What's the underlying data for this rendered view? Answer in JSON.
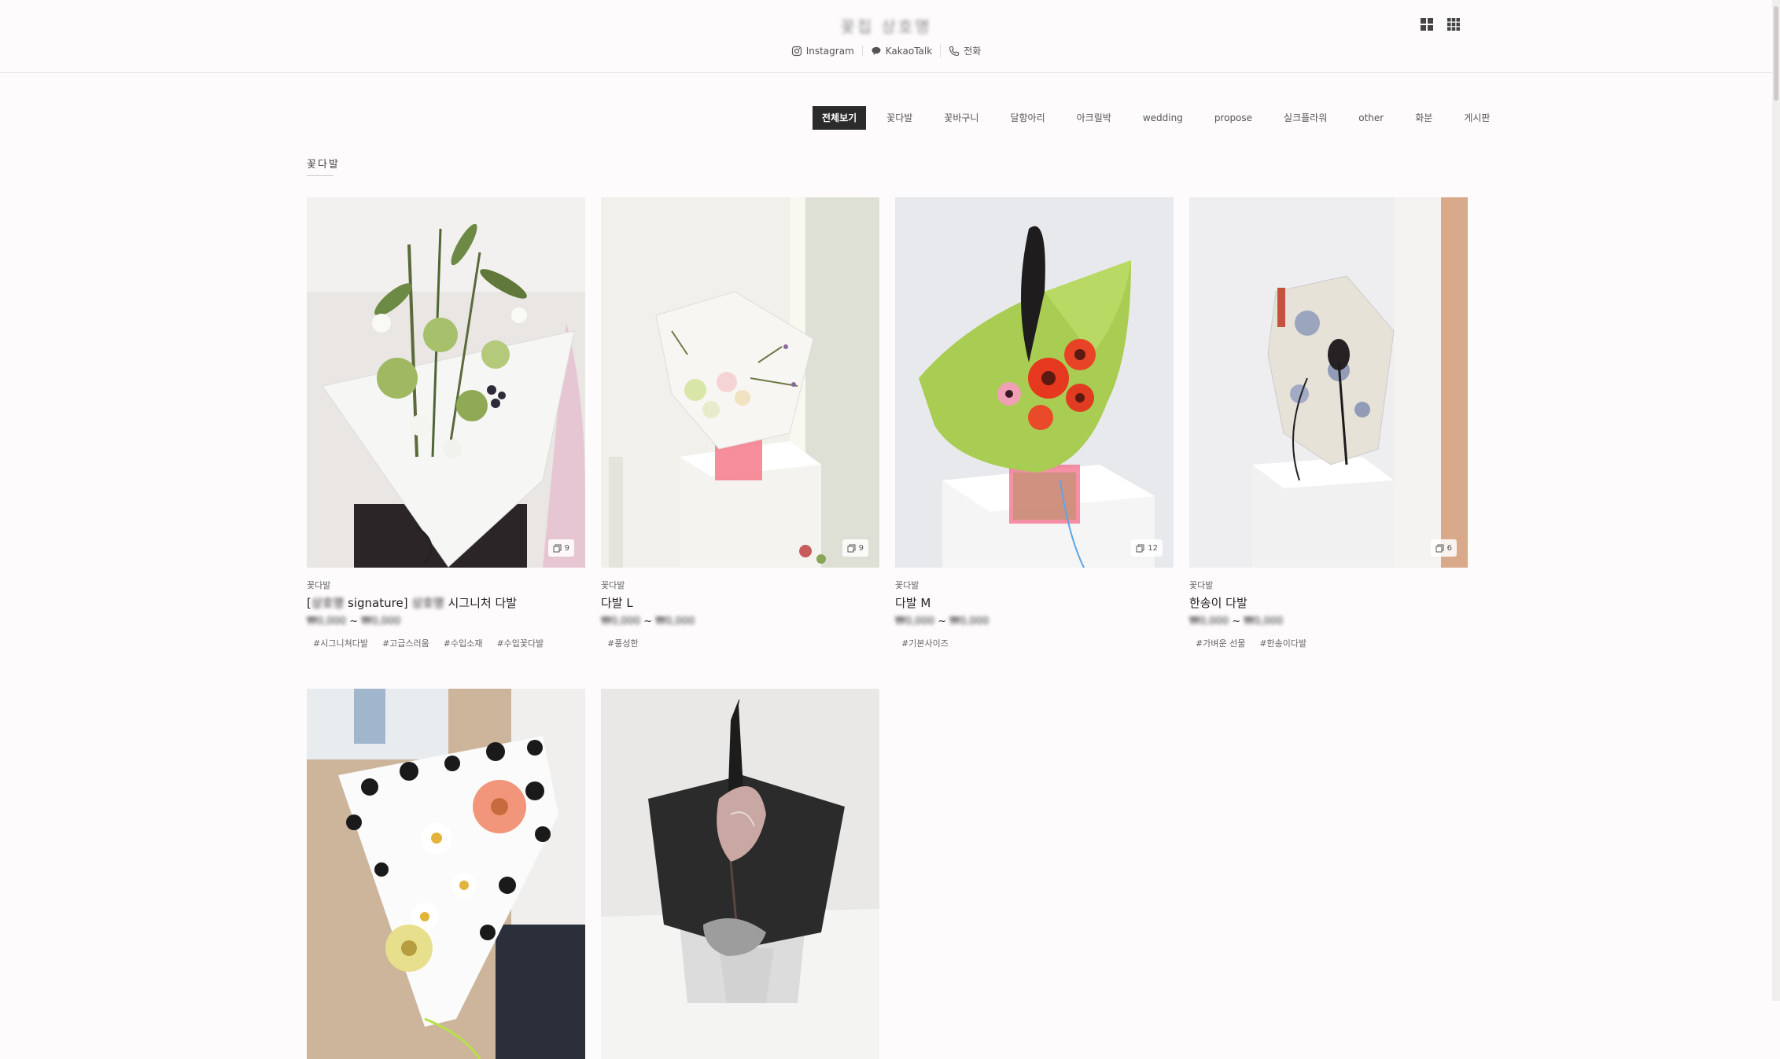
{
  "header": {
    "logo_text": "꽃집 상호명",
    "contacts": [
      {
        "label": "Instagram",
        "icon": "instagram-icon"
      },
      {
        "label": "KakaoTalk",
        "icon": "chat-bubble-icon"
      },
      {
        "label": "전화",
        "icon": "phone-icon"
      }
    ],
    "view_toggles": [
      "grid-2x2-icon",
      "grid-3x3-icon"
    ]
  },
  "tabs": [
    {
      "label": "전체보기",
      "active": true
    },
    {
      "label": "꽃다발",
      "active": false
    },
    {
      "label": "꽃바구니",
      "active": false
    },
    {
      "label": "달항아리",
      "active": false
    },
    {
      "label": "아크릴박",
      "active": false
    },
    {
      "label": "wedding",
      "active": false
    },
    {
      "label": "propose",
      "active": false
    },
    {
      "label": "실크플라워",
      "active": false
    },
    {
      "label": "other",
      "active": false
    },
    {
      "label": "화분",
      "active": false
    },
    {
      "label": "게시판",
      "active": false
    }
  ],
  "section": {
    "title": "꽃다발"
  },
  "products": [
    {
      "category": "꽃다발",
      "title_pre": "[",
      "title_blur_1": "상호명",
      "title_mid": " signature] ",
      "title_blur_2": "상호명",
      "title_post": " 시그니처 다발",
      "price_low": "₩0,000",
      "price_sep": " ~ ",
      "price_high": "₩0,000",
      "image_count": "9",
      "tags": [
        "#시그니쳐다발",
        "#고급스러움",
        "#수입소재",
        "#수입꽃다발"
      ]
    },
    {
      "category": "꽃다발",
      "title": "다발 L",
      "price_low": "₩0,000",
      "price_sep": " ~ ",
      "price_high": "₩0,000",
      "image_count": "9",
      "tags": [
        "#풍성한"
      ]
    },
    {
      "category": "꽃다발",
      "title": "다발 M",
      "price_low": "₩0,000",
      "price_sep": " ~ ",
      "price_high": "₩0,000",
      "image_count": "12",
      "tags": [
        "#기본사이즈"
      ]
    },
    {
      "category": "꽃다발",
      "title": "한송이 다발",
      "price_low": "₩0,000",
      "price_sep": " ~ ",
      "price_high": "₩0,000",
      "image_count": "6",
      "tags": [
        "#가벼운 선물",
        "#한송이다발"
      ]
    },
    {
      "category": "",
      "title": ""
    },
    {
      "category": "",
      "title": ""
    }
  ]
}
